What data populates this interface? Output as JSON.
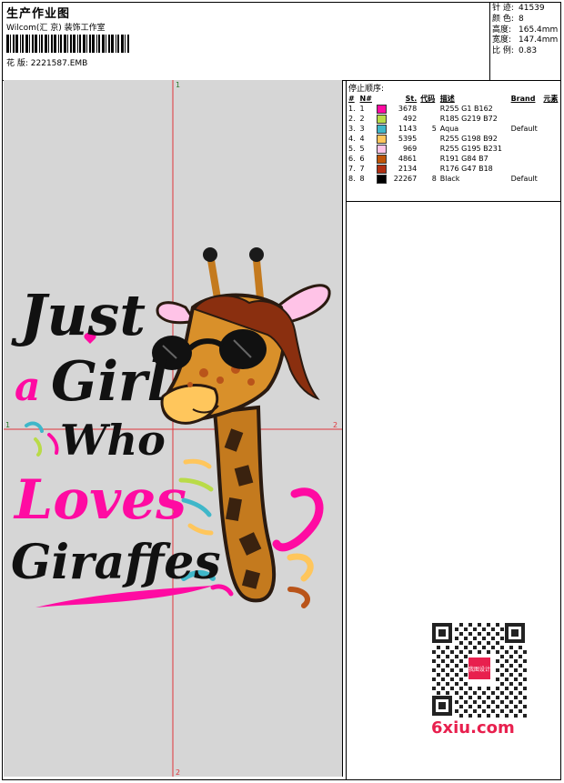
{
  "header": {
    "title": "生产作业图",
    "company": "Wilcom(汇 京) 装饰工作室",
    "design_label": "花 版:",
    "design_value": "2221587.EMB"
  },
  "stats": [
    {
      "label": "针 迹:",
      "value": "41539"
    },
    {
      "label": "颜 色:",
      "value": "8"
    },
    {
      "label": "高度:",
      "value": "165.4mm"
    },
    {
      "label": "宽度:",
      "value": "147.4mm"
    },
    {
      "label": "比 例:",
      "value": "0.83"
    }
  ],
  "thread_table": {
    "title": "停止顺序:",
    "headers": [
      "#",
      "N#",
      "St.",
      "代码",
      "描述",
      "Brand",
      "元素"
    ],
    "rows": [
      {
        "idx": "1.",
        "n": "1",
        "color": "#ff0ba2",
        "st": "3678",
        "code": "",
        "desc": "R255 G1 B162",
        "brand": ""
      },
      {
        "idx": "2.",
        "n": "2",
        "color": "#b9db48",
        "st": "492",
        "code": "",
        "desc": "R185 G219 B72",
        "brand": ""
      },
      {
        "idx": "3.",
        "n": "3",
        "color": "#3fb7c9",
        "st": "1143",
        "code": "5",
        "desc": "Aqua",
        "brand": "Default"
      },
      {
        "idx": "4.",
        "n": "4",
        "color": "#ffc65c",
        "st": "5395",
        "code": "",
        "desc": "R255 G198 B92",
        "brand": ""
      },
      {
        "idx": "5.",
        "n": "5",
        "color": "#ffc3e7",
        "st": "969",
        "code": "",
        "desc": "R255 G195 B231",
        "brand": ""
      },
      {
        "idx": "6.",
        "n": "6",
        "color": "#bf5407",
        "st": "4861",
        "code": "",
        "desc": "R191 G84 B7",
        "brand": ""
      },
      {
        "idx": "7.",
        "n": "7",
        "color": "#b02f12",
        "st": "2134",
        "code": "",
        "desc": "R176 G47 B18",
        "brand": ""
      },
      {
        "idx": "8.",
        "n": "8",
        "color": "#000000",
        "st": "22267",
        "code": "8",
        "desc": "Black",
        "brand": "Default"
      }
    ]
  },
  "artwork": {
    "lines": [
      "Just",
      "a",
      "Girl",
      "Who",
      "Loves",
      "Giraffes"
    ],
    "axis_marks": {
      "top": "1",
      "left": "1",
      "right": "2",
      "bottom": "2"
    }
  },
  "watermark": "6xiu.com",
  "qr_badge": "我图设计"
}
